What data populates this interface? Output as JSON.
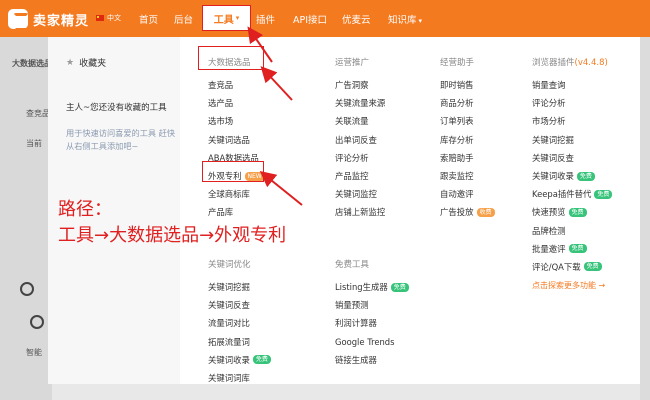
{
  "brand": {
    "name": "卖家精灵",
    "lang": "中文"
  },
  "nav": {
    "home": "首页",
    "admin": "后台",
    "tools": "工具",
    "plugin": "插件",
    "api": "API接口",
    "youmaiyun": "优麦云",
    "knowledge": "知识库"
  },
  "background": {
    "left_text_1": "大数据选品",
    "left_text_2": "查竞品",
    "left_text_3": "当前",
    "left_text_4": "智能"
  },
  "favorites": {
    "title": "收藏夹",
    "empty": "主人~您还没有收藏的工具",
    "hint": "用于快速访问喜爱的工具 赶快从右侧工具添加吧~"
  },
  "columns": {
    "big_data": {
      "title": "大数据选品",
      "items": [
        "查竞品",
        "选产品",
        "选市场",
        "关键词选品",
        "ABA数据选品",
        "外观专利",
        "全球商标库",
        "产品库"
      ],
      "badge_new": "NEW"
    },
    "operations": {
      "title": "运营推广",
      "items": [
        "广告洞察",
        "关键流量来源",
        "关联流量",
        "出单词反查",
        "评论分析",
        "产品监控",
        "关键词监控",
        "店铺上新监控"
      ]
    },
    "assistant": {
      "title": "经营助手",
      "items": [
        "即时销售",
        "商品分析",
        "订单列表",
        "库存分析",
        "索赔助手",
        "跟卖监控",
        "自动邀评",
        "广告投放"
      ],
      "badge_fee": "收费"
    },
    "browser": {
      "title": "浏览器插件",
      "version": "(v4.4.8)",
      "items": [
        "销量查询",
        "评论分析",
        "市场分析",
        "关键词挖掘",
        "关键词反查",
        "关键词收录",
        "Keepa插件替代",
        "快速预览",
        "品牌检测",
        "批量邀评",
        "评论/QA下载"
      ],
      "badge_free": "免费",
      "more": "点击探索更多功能 →"
    },
    "keyword": {
      "title": "关键词优化",
      "items": [
        "关键词挖掘",
        "关键词反查",
        "流量词对比",
        "拓展流量词",
        "关键词收录",
        "关键词词库"
      ]
    },
    "free": {
      "title": "免费工具",
      "items": [
        "Listing生成器",
        "销量预测",
        "利润计算器",
        "Google Trends",
        "链接生成器"
      ]
    }
  },
  "annotation": {
    "line1": "路径：",
    "line2": "工具→大数据选品→外观专利"
  },
  "colors": {
    "brand_orange": "#f47a20",
    "annotation_red": "#e02020"
  }
}
